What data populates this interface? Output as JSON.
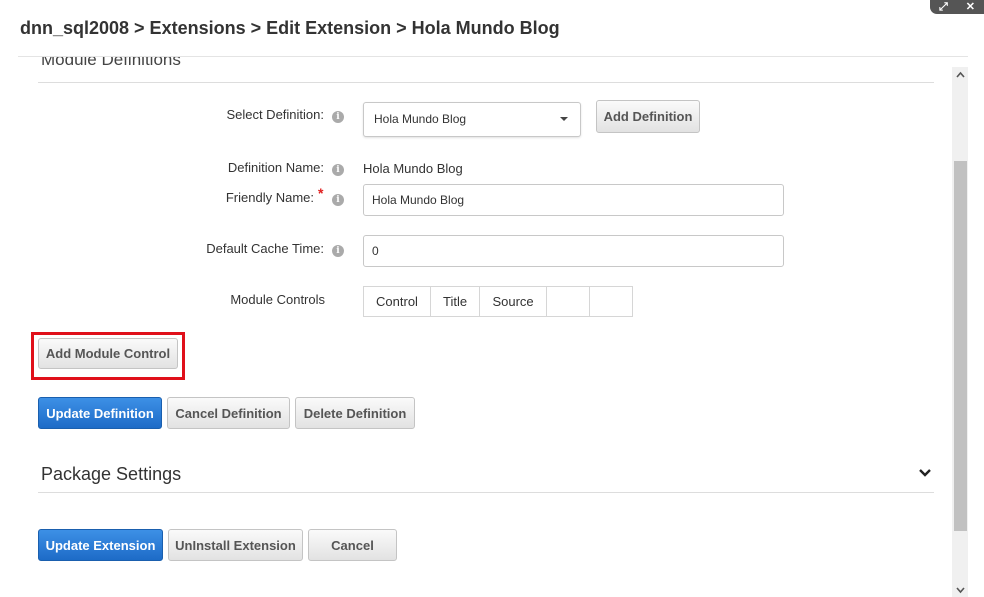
{
  "window": {
    "expand_icon": "expand-icon",
    "close_icon": "close-icon",
    "expand_glyph": "⤢",
    "close_glyph": "✕"
  },
  "breadcrumb": "dnn_sql2008 > Extensions > Edit Extension > Hola Mundo Blog",
  "module_definitions": {
    "section_title": "Module Definitions",
    "select_definition": {
      "label": "Select Definition:",
      "selected": "Hola Mundo Blog",
      "add_button": "Add Definition"
    },
    "definition_name": {
      "label": "Definition Name:",
      "value": "Hola Mundo Blog"
    },
    "friendly_name": {
      "label": "Friendly Name:",
      "required_mark": "*",
      "value": "Hola Mundo Blog"
    },
    "default_cache_time": {
      "label": "Default Cache Time:",
      "value": "0"
    },
    "module_controls": {
      "label": "Module Controls",
      "columns": [
        "Control",
        "Title",
        "Source",
        "",
        ""
      ]
    },
    "add_module_control_button": "Add Module Control",
    "update_button": "Update Definition",
    "cancel_button": "Cancel Definition",
    "delete_button": "Delete Definition",
    "highlight_color": "#e0101a"
  },
  "package_settings": {
    "title": "Package Settings",
    "chevron_icon": "chevron-down-icon"
  },
  "footer": {
    "update_button": "Update Extension",
    "uninstall_button": "UnInstall Extension",
    "cancel_button": "Cancel"
  },
  "info_glyph": "i",
  "colors": {
    "primary": "#1d6bc7",
    "required": "#e02020"
  }
}
